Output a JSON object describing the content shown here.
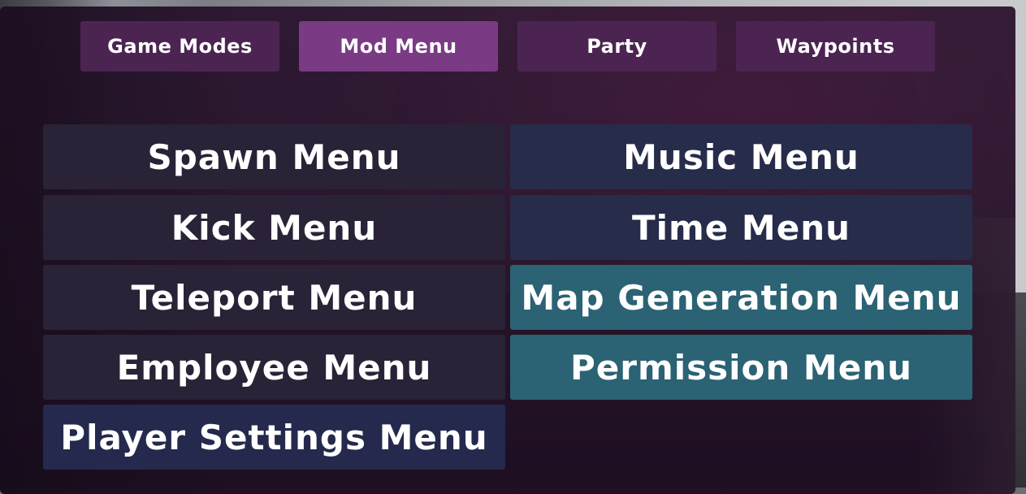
{
  "tabs": [
    {
      "label": "Game Modes",
      "active": false
    },
    {
      "label": "Mod Menu",
      "active": true
    },
    {
      "label": "Party",
      "active": false
    },
    {
      "label": "Waypoints",
      "active": false
    }
  ],
  "menus": {
    "spawn": "Spawn Menu",
    "music": "Music Menu",
    "kick": "Kick Menu",
    "time": "Time Menu",
    "teleport": "Teleport Menu",
    "map_generation": "Map Generation Menu",
    "employee": "Employee Menu",
    "permission": "Permission Menu",
    "player_settings": "Player Settings Menu"
  },
  "colors": {
    "panel": "#2c1630",
    "tab": "#4c2452",
    "tab_active": "#7a3a84",
    "button_dark": "#2a2236",
    "button_navy": "#262c4a",
    "button_teal": "#2b6274",
    "text": "#ffffff"
  }
}
